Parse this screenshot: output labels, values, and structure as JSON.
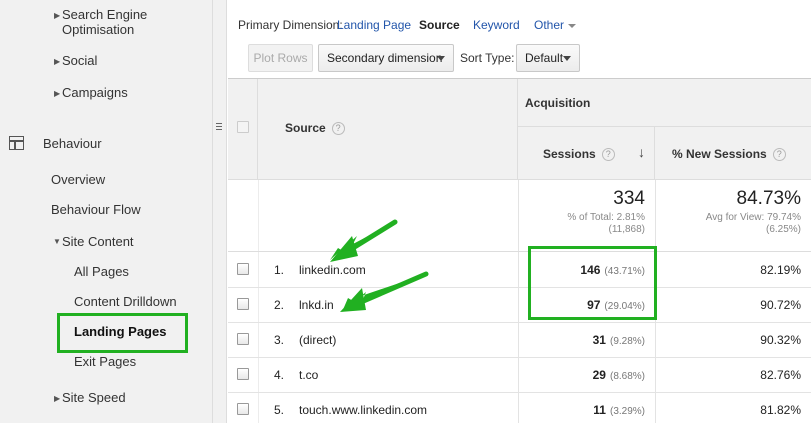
{
  "sidebar": {
    "items": [
      {
        "label": "Search Engine"
      },
      {
        "label": "Optimisation"
      },
      {
        "label": "Social"
      },
      {
        "label": "Campaigns"
      },
      {
        "label": "Behaviour"
      },
      {
        "label": "Overview"
      },
      {
        "label": "Behaviour Flow"
      },
      {
        "label": "Site Content"
      },
      {
        "label": "All Pages"
      },
      {
        "label": "Content Drilldown"
      },
      {
        "label": "Landing Pages"
      },
      {
        "label": "Exit Pages"
      },
      {
        "label": "Site Speed"
      }
    ]
  },
  "dimension_bar": {
    "label": "Primary Dimension:",
    "options": [
      "Landing Page",
      "Source",
      "Keyword",
      "Other"
    ],
    "active": "Source"
  },
  "toolbar": {
    "plot_rows": "Plot Rows",
    "secondary_dimension": "Secondary dimension",
    "sort_type_label": "Sort Type:",
    "sort_type_value": "Default"
  },
  "table": {
    "source_header": "Source",
    "acquisition_header": "Acquisition",
    "sessions_header": "Sessions",
    "new_sessions_header": "% New Sessions",
    "help_glyph": "?",
    "sort_glyph": "↓",
    "summary": {
      "sessions_total": "334",
      "sessions_pct_label": "% of Total: 2.81%",
      "sessions_pct_total": "(11,868)",
      "new_sessions_total": "84.73%",
      "new_sessions_avg_label": "Avg for View: 79.74%",
      "new_sessions_avg_delta": "(6.25%)"
    },
    "rows": [
      {
        "num": "1.",
        "source": "linkedin.com",
        "sessions": "146",
        "pct": "(43.71%)",
        "new_sessions": "82.19%"
      },
      {
        "num": "2.",
        "source": "lnkd.in",
        "sessions": "97",
        "pct": "(29.04%)",
        "new_sessions": "90.72%"
      },
      {
        "num": "3.",
        "source": "(direct)",
        "sessions": "31",
        "pct": "(9.28%)",
        "new_sessions": "90.32%"
      },
      {
        "num": "4.",
        "source": "t.co",
        "sessions": "29",
        "pct": "(8.68%)",
        "new_sessions": "82.76%"
      },
      {
        "num": "5.",
        "source": "touch.www.linkedin.com",
        "sessions": "11",
        "pct": "(3.29%)",
        "new_sessions": "81.82%"
      }
    ]
  },
  "colors": {
    "highlight": "#21b021",
    "link": "#2255aa"
  }
}
